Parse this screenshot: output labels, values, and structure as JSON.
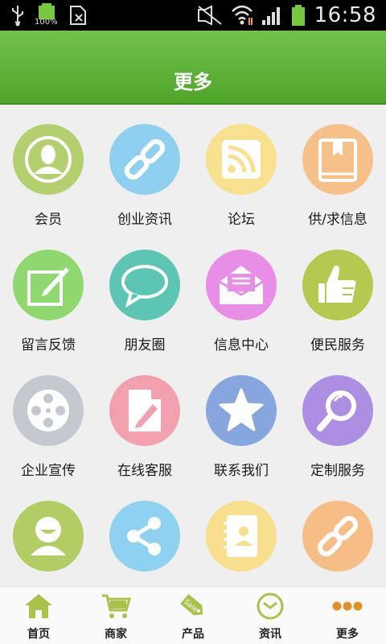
{
  "status_bar": {
    "time": "16:58",
    "battery_label": "100%",
    "icons": [
      "usb-icon",
      "battery-full-icon",
      "sim-card-icon",
      "mute-icon",
      "wifi-icon",
      "signal-icon",
      "battery-icon"
    ]
  },
  "header": {
    "title": "更多"
  },
  "grid": {
    "items": [
      {
        "label": "会员",
        "icon": "member-icon",
        "color": "#b4cf6e"
      },
      {
        "label": "创业资讯",
        "icon": "link-icon",
        "color": "#8fd0f0"
      },
      {
        "label": "论坛",
        "icon": "rss-icon",
        "color": "#f7e08e"
      },
      {
        "label": "供/求信息",
        "icon": "book-icon",
        "color": "#f6c08b"
      },
      {
        "label": "留言反馈",
        "icon": "note-edit-icon",
        "color": "#8ed86f"
      },
      {
        "label": "朋友圈",
        "icon": "chat-bubble-icon",
        "color": "#5cc5b4"
      },
      {
        "label": "信息中心",
        "icon": "mail-icon",
        "color": "#e98ee6"
      },
      {
        "label": "便民服务",
        "icon": "thumbs-up-icon",
        "color": "#b6c84f"
      },
      {
        "label": "企业宣传",
        "icon": "film-reel-icon",
        "color": "#c4c9cf"
      },
      {
        "label": "在线客服",
        "icon": "document-edit-icon",
        "color": "#f3a0ae"
      },
      {
        "label": "联系我们",
        "icon": "star-icon",
        "color": "#88a6de"
      },
      {
        "label": "定制服务",
        "icon": "magnifier-icon",
        "color": "#ac8ee3"
      },
      {
        "label": "",
        "icon": "smiley-user-icon",
        "color": "#b1cd64"
      },
      {
        "label": "",
        "icon": "share-icon",
        "color": "#8fd1f1"
      },
      {
        "label": "",
        "icon": "contacts-icon",
        "color": "#f7df8d"
      },
      {
        "label": "",
        "icon": "link-icon",
        "color": "#f6bd86"
      }
    ]
  },
  "bottom_nav": {
    "items": [
      {
        "label": "首页",
        "icon": "home-icon"
      },
      {
        "label": "商家",
        "icon": "cart-icon"
      },
      {
        "label": "产品",
        "icon": "sale-tag-icon",
        "tag_text": "Sale"
      },
      {
        "label": "资讯",
        "icon": "clock-icon"
      },
      {
        "label": "更多",
        "icon": "more-dots-icon"
      }
    ],
    "accent_color": "#a8c24a"
  }
}
